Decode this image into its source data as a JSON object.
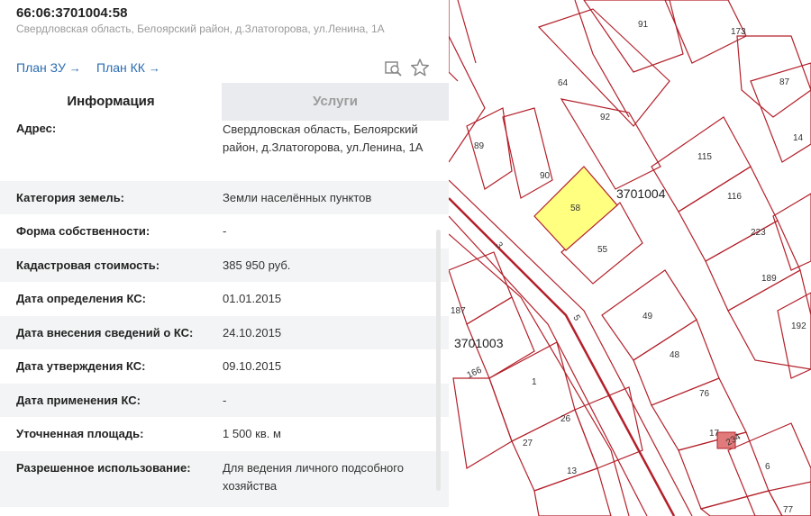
{
  "header": {
    "cadastral_number": "66:06:3701004:58",
    "address_line": "Свердловская область, Белоярский район, д.Златогорова, ул.Ленина, 1А"
  },
  "links": {
    "plan_zu": "План ЗУ",
    "plan_kk": "План КК",
    "arrow": "→"
  },
  "icons": [
    "search-map-icon",
    "star-icon"
  ],
  "tabs": {
    "info": "Информация",
    "services": "Услуги"
  },
  "info_rows": [
    {
      "label": "Адрес:",
      "value": "Свердловская область, Белоярский район, д.Златогорова, ул.Ленина, 1А"
    },
    {
      "label": "Категория земель:",
      "value": "Земли населённых пунктов"
    },
    {
      "label": "Форма собственности:",
      "value": "-"
    },
    {
      "label": "Кадастровая стоимость:",
      "value": "385 950 руб."
    },
    {
      "label": "Дата определения КС:",
      "value": "01.01.2015"
    },
    {
      "label": "Дата внесения сведений о КС:",
      "value": "24.10.2015"
    },
    {
      "label": "Дата утверждения КС:",
      "value": "09.10.2015"
    },
    {
      "label": "Дата применения КС:",
      "value": "-"
    },
    {
      "label": "Уточненная площадь:",
      "value": "1 500 кв. м"
    },
    {
      "label": "Разрешенное использование:",
      "value": "Для ведения личного подсобного хозяйства"
    }
  ],
  "map": {
    "parcel_color": "#ffff80",
    "line_color": "#b3202a",
    "selected_parcel": "58",
    "quarter_labels": [
      "3701004",
      "3701003"
    ],
    "parcel_labels": [
      "91",
      "173",
      "64",
      "87",
      "92",
      "14",
      "89",
      "90",
      "115",
      "116",
      "223",
      "55",
      "189",
      "187",
      "3",
      "5",
      "49",
      "192",
      "166",
      "48",
      "1",
      "76",
      "26",
      "27",
      "17",
      "234",
      "13",
      "6",
      "77"
    ]
  }
}
